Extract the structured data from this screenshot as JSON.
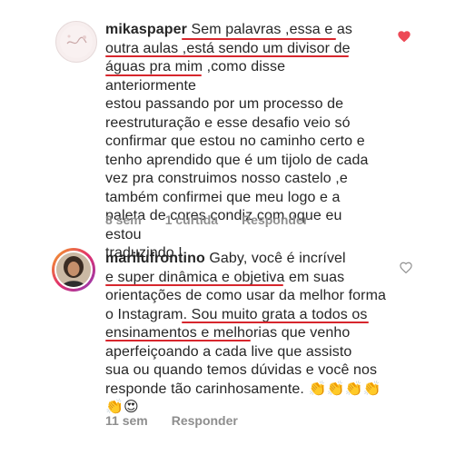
{
  "comments": [
    {
      "username": "mikaspaper",
      "text": " Sem palavras ,essa e as\noutra aulas ,está sendo um divisor de\náguas pra mim ,como disse anteriormente\nestou passando por um processo de\nreestruturação e esse desafio veio só\nconfirmar que estou no caminho certo e\ntenho aprendido que é um tijolo de cada\nvez pra construimos nosso castelo ,e\ntambém confirmei que meu logo e a\npaleta de cores condiz com oque eu estou\ntraduzindo !",
      "time": "8 sem",
      "likes": "1 curtida",
      "reply": "Responder",
      "liked": true
    },
    {
      "username": "marilufrontino",
      "text": " Gaby, você é incrível\ne super dinâmica e objetiva em suas\norientações de como usar da melhor forma\no Instagram. Sou muito grata a todos os\nensinamentos e melhorias que venho\naperfeiçoando a cada live que assisto\nsua ou quando temos dúvidas e você nos\nresponde tão carinhosamente. 👏👏👏👏\n👏😍",
      "time": "11 sem",
      "reply": "Responder",
      "liked": false
    }
  ],
  "colors": {
    "liked_heart": "#ed4956",
    "annotation": "#d7262d",
    "meta_text": "#8e8e8e"
  },
  "icons": [
    "heart-filled-icon",
    "heart-outline-icon"
  ]
}
